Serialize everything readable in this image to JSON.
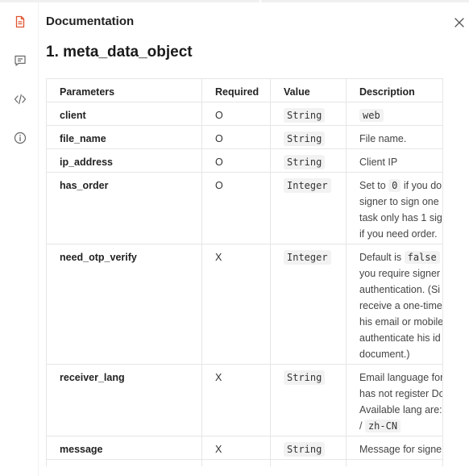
{
  "panel": {
    "title": "Documentation"
  },
  "rail": {
    "items": [
      {
        "name": "document-icon",
        "color": "#e0542e"
      },
      {
        "name": "comment-icon",
        "color": "#666666"
      },
      {
        "name": "code-icon",
        "color": "#666666"
      },
      {
        "name": "info-icon",
        "color": "#666666"
      }
    ]
  },
  "section": {
    "title": "1. meta_data_object"
  },
  "table": {
    "headers": [
      "Parameters",
      "Required",
      "Value",
      "Description"
    ],
    "rows": [
      {
        "param": "client",
        "required": "O",
        "value": "String",
        "desc_lines": [
          [
            {
              "code": "web"
            }
          ]
        ]
      },
      {
        "param": "file_name",
        "required": "O",
        "value": "String",
        "desc_lines": [
          [
            {
              "t": "File name."
            }
          ]
        ]
      },
      {
        "param": "ip_address",
        "required": "O",
        "value": "String",
        "desc_lines": [
          [
            {
              "t": "Client IP"
            }
          ]
        ]
      },
      {
        "param": "has_order",
        "required": "O",
        "value": "Integer",
        "desc_lines": [
          [
            {
              "t": "Set to "
            },
            {
              "code": "0"
            },
            {
              "t": " if you do"
            }
          ],
          [
            {
              "t": "signer to sign one"
            }
          ],
          [
            {
              "t": "task only has 1 sig"
            }
          ],
          [
            {
              "t": "if you need order."
            }
          ]
        ]
      },
      {
        "param": "need_otp_verify",
        "required": "X",
        "value": "Integer",
        "desc_lines": [
          [
            {
              "t": "Default is "
            },
            {
              "code": "false"
            }
          ],
          [
            {
              "t": "you require signer"
            }
          ],
          [
            {
              "t": "authentication. (Si"
            }
          ],
          [
            {
              "t": "receive a one-time"
            }
          ],
          [
            {
              "t": "his email or mobile"
            }
          ],
          [
            {
              "t": "authenticate his id"
            }
          ],
          [
            {
              "t": "document.)"
            }
          ]
        ]
      },
      {
        "param": "receiver_lang",
        "required": "X",
        "value": "String",
        "desc_lines": [
          [
            {
              "t": "Email language for"
            }
          ],
          [
            {
              "t": "has not register Do"
            }
          ],
          [
            {
              "t": "Available lang are:"
            }
          ],
          [
            {
              "t": "/ "
            },
            {
              "code": "zh-CN"
            }
          ]
        ]
      },
      {
        "param": "message",
        "required": "X",
        "value": "String",
        "desc_lines": [
          [
            {
              "t": "Message for signe"
            }
          ]
        ]
      },
      {
        "param": "",
        "required": "",
        "value": "",
        "desc_lines": []
      }
    ]
  }
}
